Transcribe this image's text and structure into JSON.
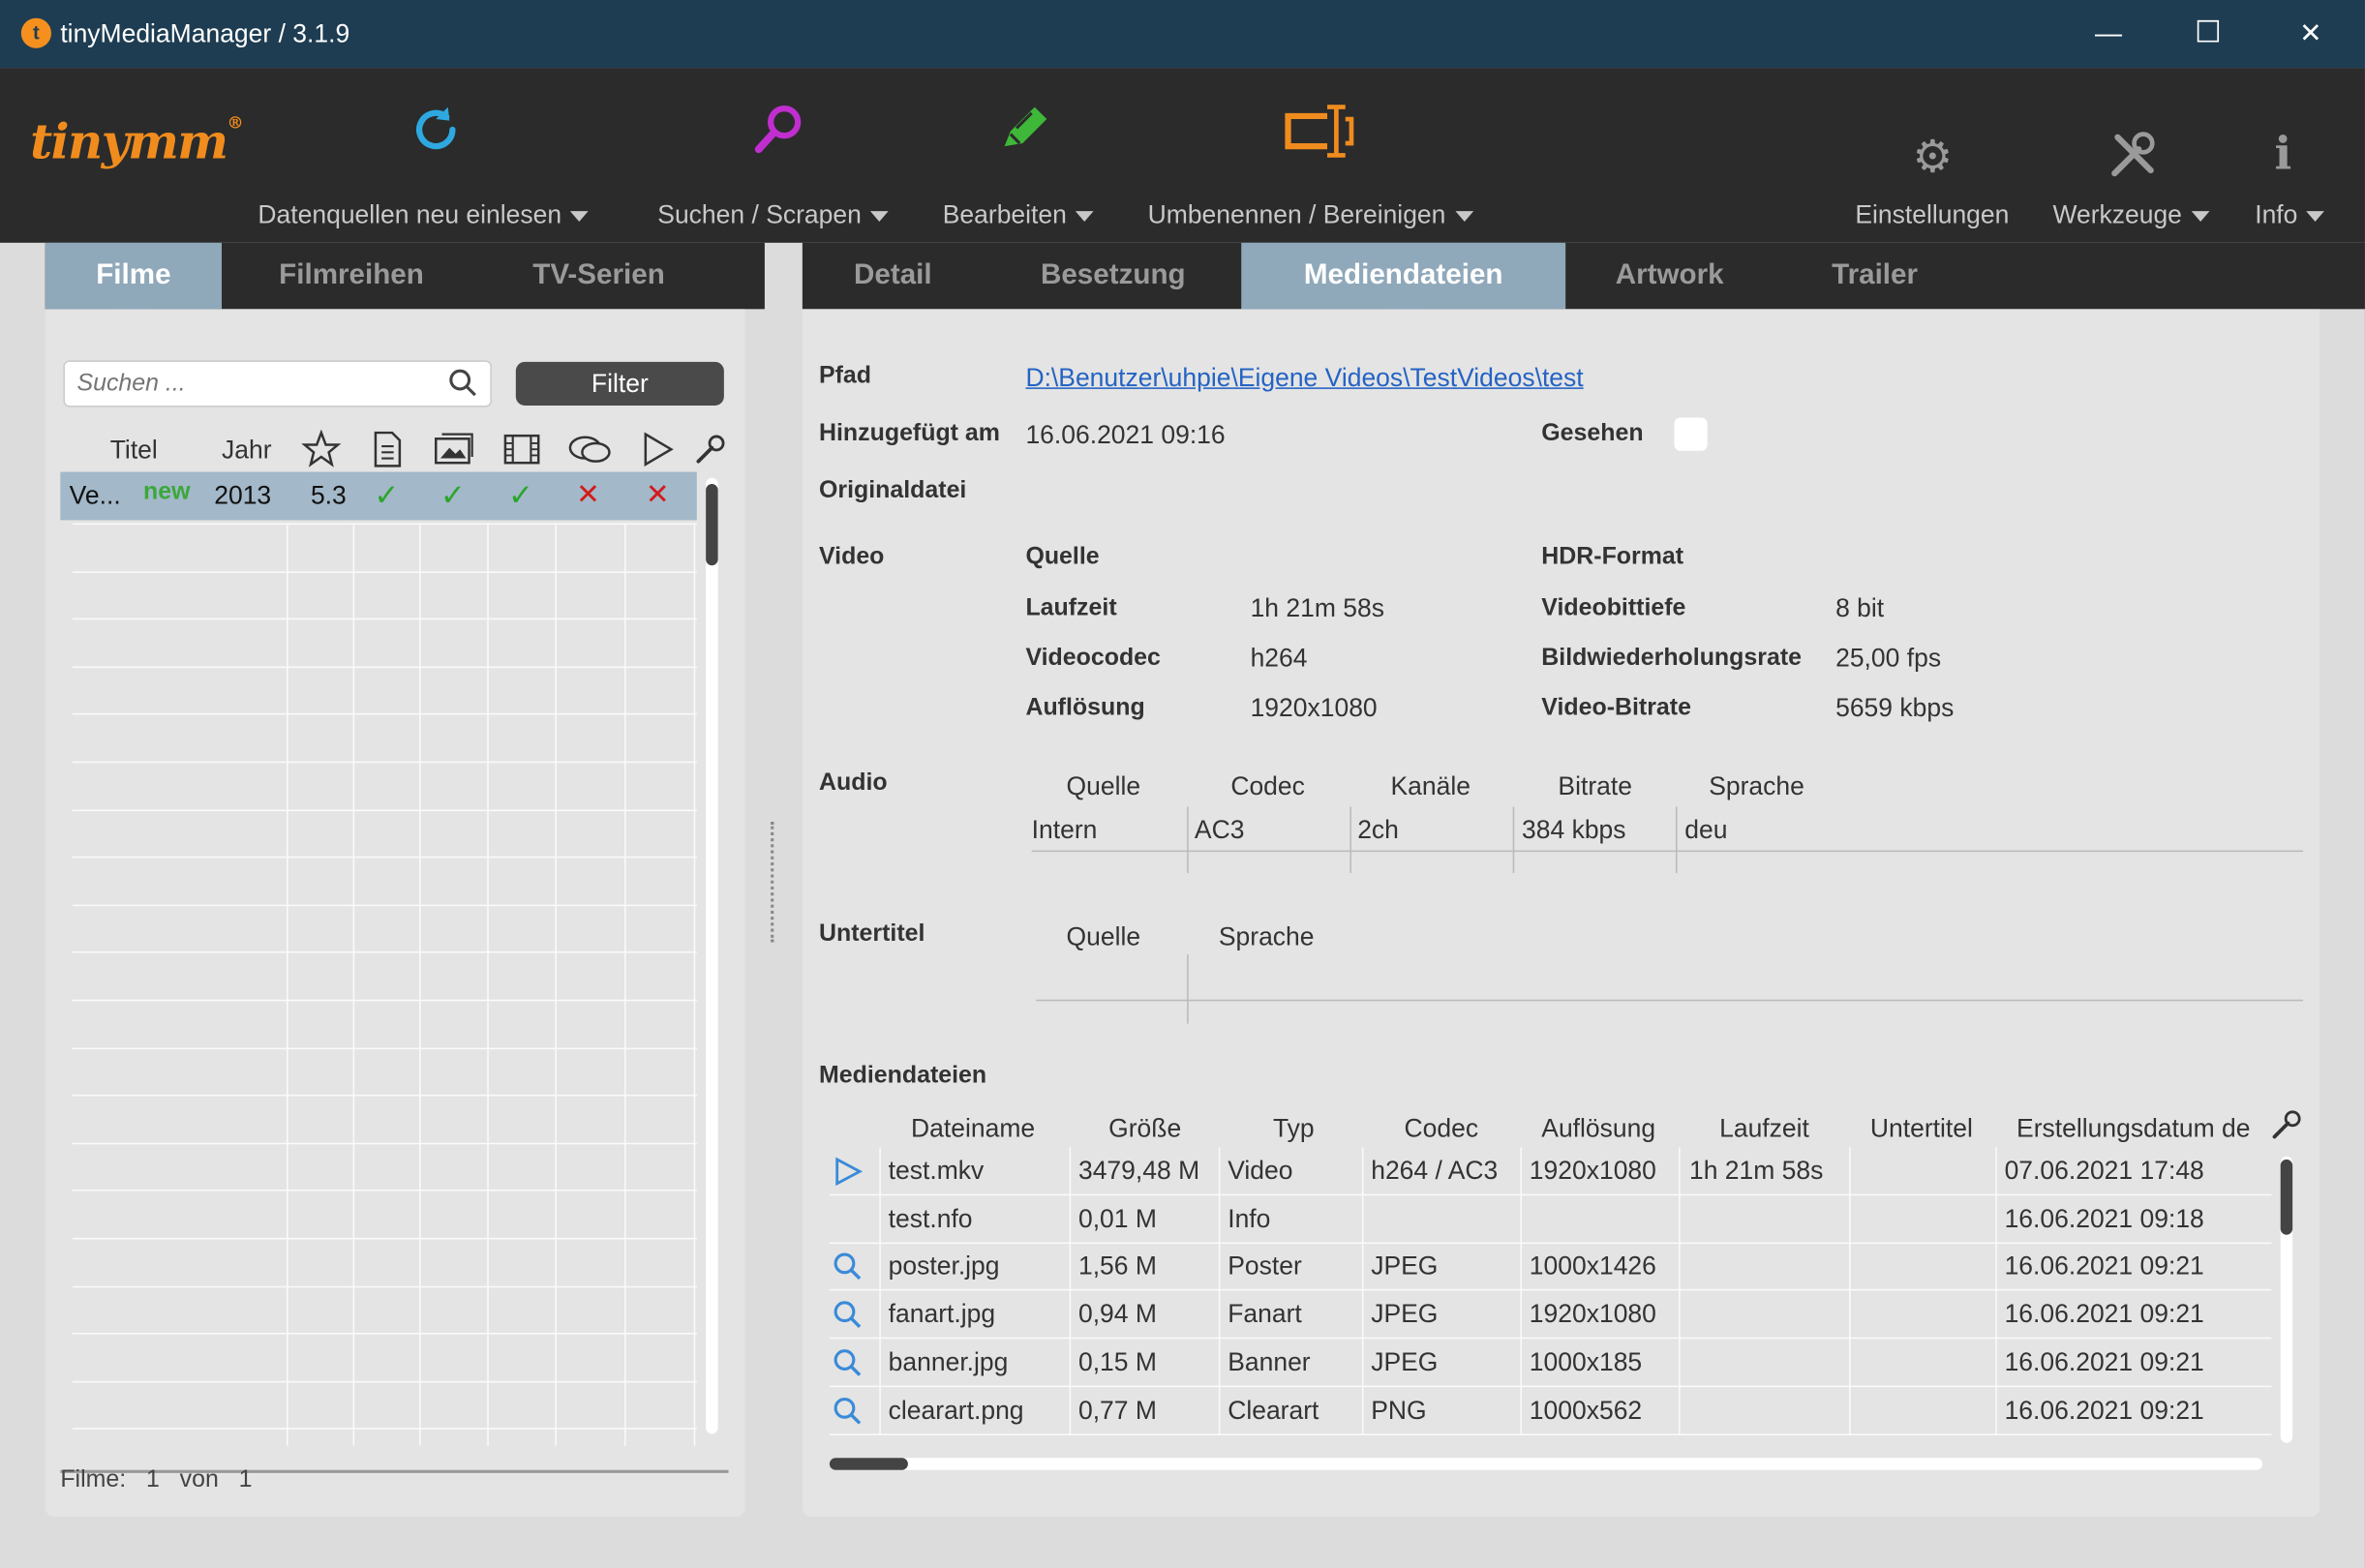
{
  "window": {
    "title": "tinyMediaManager / 3.1.9",
    "min": "—",
    "max": "☐",
    "close": "✕"
  },
  "logo": {
    "text": "tinymm",
    "mark": "®"
  },
  "toolbar": {
    "update_label": "Datenquellen neu einlesen",
    "search_label": "Suchen / Scrapen",
    "edit_label": "Bearbeiten",
    "rename_label": "Umbenennen / Bereinigen",
    "settings_label": "Einstellungen",
    "tools_label": "Werkzeuge",
    "info_label": "Info"
  },
  "left_tabs": [
    "Filme",
    "Filmreihen",
    "TV-Serien"
  ],
  "right_tabs": [
    "Detail",
    "Besetzung",
    "Mediendateien",
    "Artwork",
    "Trailer"
  ],
  "search": {
    "placeholder": "Suchen ..."
  },
  "filter_label": "Filter",
  "movie_table": {
    "headers": {
      "title": "Titel",
      "year": "Jahr"
    },
    "row": {
      "title": "Ve...",
      "badge": "new",
      "year": "2013",
      "rating": "5.3",
      "check": "✓",
      "cross": "✕"
    }
  },
  "status": {
    "label": "Filme:",
    "count": "1",
    "of": "von",
    "total": "1"
  },
  "details": {
    "path_label": "Pfad",
    "path_value": "D:\\Benutzer\\uhpie\\Eigene Videos\\TestVideos\\test",
    "added_label": "Hinzugefügt am",
    "added_value": "16.06.2021 09:16",
    "watched_label": "Gesehen",
    "original_label": "Originaldatei",
    "video_label": "Video",
    "source_label": "Quelle",
    "hdr_label": "HDR-Format",
    "runtime_label": "Laufzeit",
    "runtime_value": "1h 21m 58s",
    "bitdepth_label": "Videobittiefe",
    "bitdepth_value": "8 bit",
    "codec_label": "Videocodec",
    "codec_value": "h264",
    "framerate_label": "Bildwiederholungsrate",
    "framerate_value": "25,00 fps",
    "resolution_label": "Auflösung",
    "resolution_value": "1920x1080",
    "bitrate_label": "Video-Bitrate",
    "bitrate_value": "5659 kbps",
    "audio_label": "Audio",
    "audio_headers": [
      "Quelle",
      "Codec",
      "Kanäle",
      "Bitrate",
      "Sprache"
    ],
    "audio_row": [
      "Intern",
      "AC3",
      "2ch",
      "384 kbps",
      "deu"
    ],
    "subtitle_label": "Untertitel",
    "subtitle_headers": [
      "Quelle",
      "Sprache"
    ],
    "mediafiles_label": "Mediendateien"
  },
  "mediafiles": {
    "headers": [
      "Dateiname",
      "Größe",
      "Typ",
      "Codec",
      "Auflösung",
      "Laufzeit",
      "Untertitel",
      "Erstellungsdatum de"
    ],
    "rows": [
      {
        "icon": "▷",
        "name": "test.mkv",
        "size": "3479,48 M",
        "type": "Video",
        "codec": "h264 / AC3",
        "res": "1920x1080",
        "runtime": "1h 21m 58s",
        "date": "07.06.2021 17:48"
      },
      {
        "icon": "",
        "name": "test.nfo",
        "size": "0,01 M",
        "type": "Info",
        "codec": "",
        "res": "",
        "runtime": "",
        "date": "16.06.2021 09:18"
      },
      {
        "icon": "🔍",
        "name": "poster.jpg",
        "size": "1,56 M",
        "type": "Poster",
        "codec": "JPEG",
        "res": "1000x1426",
        "runtime": "",
        "date": "16.06.2021 09:21"
      },
      {
        "icon": "🔍",
        "name": "fanart.jpg",
        "size": "0,94 M",
        "type": "Fanart",
        "codec": "JPEG",
        "res": "1920x1080",
        "runtime": "",
        "date": "16.06.2021 09:21"
      },
      {
        "icon": "🔍",
        "name": "banner.jpg",
        "size": "0,15 M",
        "type": "Banner",
        "codec": "JPEG",
        "res": "1000x185",
        "runtime": "",
        "date": "16.06.2021 09:21"
      },
      {
        "icon": "🔍",
        "name": "clearart.png",
        "size": "0,77 M",
        "type": "Clearart",
        "codec": "PNG",
        "res": "1000x562",
        "runtime": "",
        "date": "16.06.2021 09:21"
      }
    ]
  }
}
